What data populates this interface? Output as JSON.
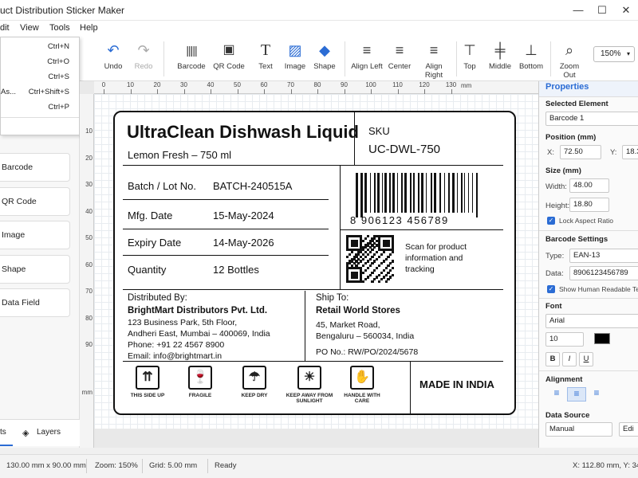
{
  "window": {
    "title": "uct Distribution Sticker Maker",
    "minimize": "—",
    "maximize": "☐",
    "close": "✕"
  },
  "menubar": {
    "items": [
      "dit",
      "View",
      "Tools",
      "Help"
    ]
  },
  "file_menu": {
    "items": [
      {
        "label": "",
        "shortcut": "Ctrl+N"
      },
      {
        "label": "",
        "shortcut": "Ctrl+O"
      },
      {
        "label": "",
        "shortcut": "Ctrl+S"
      },
      {
        "label": "As...",
        "shortcut": "Ctrl+Shift+S"
      },
      {
        "label": "",
        "shortcut": "Ctrl+P"
      }
    ]
  },
  "toolbar": {
    "undo": "Undo",
    "redo": "Redo",
    "barcode": "Barcode",
    "qrcode": "QR Code",
    "text": "Text",
    "image": "Image",
    "shape": "Shape",
    "align_left": "Align Left",
    "center": "Center",
    "align_right": "Align Right",
    "top": "Top",
    "middle": "Middle",
    "bottom": "Bottom",
    "zoom_out": "Zoom Out",
    "zoom_value": "150%"
  },
  "left_panel": {
    "items": [
      "Barcode",
      "QR Code",
      "Image",
      "Shape",
      "Data Field"
    ],
    "tabs": [
      "ts",
      "Layers"
    ]
  },
  "ruler": {
    "h": [
      "0",
      "10",
      "20",
      "30",
      "40",
      "50",
      "60",
      "70",
      "80",
      "90",
      "100",
      "110",
      "120",
      "130"
    ],
    "h_unit": "mm",
    "v": [
      "10",
      "20",
      "30",
      "40",
      "50",
      "60",
      "70",
      "80",
      "90"
    ],
    "v_unit": "mm"
  },
  "label": {
    "product_name": "UltraClean Dishwash Liquid",
    "variant": "Lemon Fresh – 750 ml",
    "sku_label": "SKU",
    "sku_value": "UC-DWL-750",
    "rows": [
      {
        "key": "Batch / Lot No.",
        "value": "BATCH-240515A"
      },
      {
        "key": "Mfg. Date",
        "value": "15-May-2024"
      },
      {
        "key": "Expiry Date",
        "value": "14-May-2026"
      },
      {
        "key": "Quantity",
        "value": "12 Bottles"
      }
    ],
    "barcode_digits": "8 906123 456789",
    "qr_caption": "Scan for product information and tracking",
    "distributed_by": {
      "title": "Distributed By:",
      "name": "BrightMart Distributors Pvt. Ltd.",
      "lines": [
        "123 Business Park, 5th Floor,",
        "Andheri East, Mumbai – 400069, India",
        "Phone: +91 22 4567 8900",
        "Email: info@brightmart.in"
      ]
    },
    "ship_to": {
      "title": "Ship To:",
      "name": "Retail World Stores",
      "lines": [
        "45, Market Road,",
        "Bengaluru – 560034, India"
      ],
      "po": "PO No.: RW/PO/2024/5678"
    },
    "symbols": [
      {
        "icon": "this-side-up-icon",
        "glyph": "⇈",
        "label": "THIS SIDE UP"
      },
      {
        "icon": "fragile-icon",
        "glyph": "🍷",
        "label": "FRAGILE"
      },
      {
        "icon": "keep-dry-icon",
        "glyph": "☂",
        "label": "KEEP DRY"
      },
      {
        "icon": "keep-away-sunlight-icon",
        "glyph": "☀",
        "label": "KEEP AWAY FROM SUNLIGHT"
      },
      {
        "icon": "handle-with-care-icon",
        "glyph": "✋",
        "label": "HANDLE WITH CARE"
      }
    ],
    "origin": "MADE IN INDIA"
  },
  "properties": {
    "title": "Properties",
    "selected_label": "Selected Element",
    "selected_value": "Barcode 1",
    "position_label": "Position (mm)",
    "x_label": "X:",
    "x_value": "72.50",
    "y_label": "Y:",
    "y_value": "18.3",
    "size_label": "Size (mm)",
    "width_label": "Width:",
    "width_value": "48.00",
    "height_label": "Height:",
    "height_value": "18.80",
    "lock_label": "Lock Aspect Ratio",
    "barcode_settings": "Barcode Settings",
    "type_label": "Type:",
    "type_value": "EAN-13",
    "data_label": "Data:",
    "data_value": "8906123456789",
    "show_hr": "Show Human Readable Text",
    "font_label": "Font",
    "font_value": "Arial",
    "font_size": "10",
    "bold": "B",
    "italic": "I",
    "underline": "U",
    "alignment": "Alignment",
    "data_source": "Data Source",
    "ds_value": "Manual",
    "edit": "Edi",
    "accent": "#2b6cd4"
  },
  "status": {
    "size": "130.00 mm x 90.00 mm",
    "zoom": "Zoom: 150%",
    "grid": "Grid: 5.00 mm",
    "state": "Ready",
    "coords": "X: 112.80 mm, Y: 34."
  }
}
